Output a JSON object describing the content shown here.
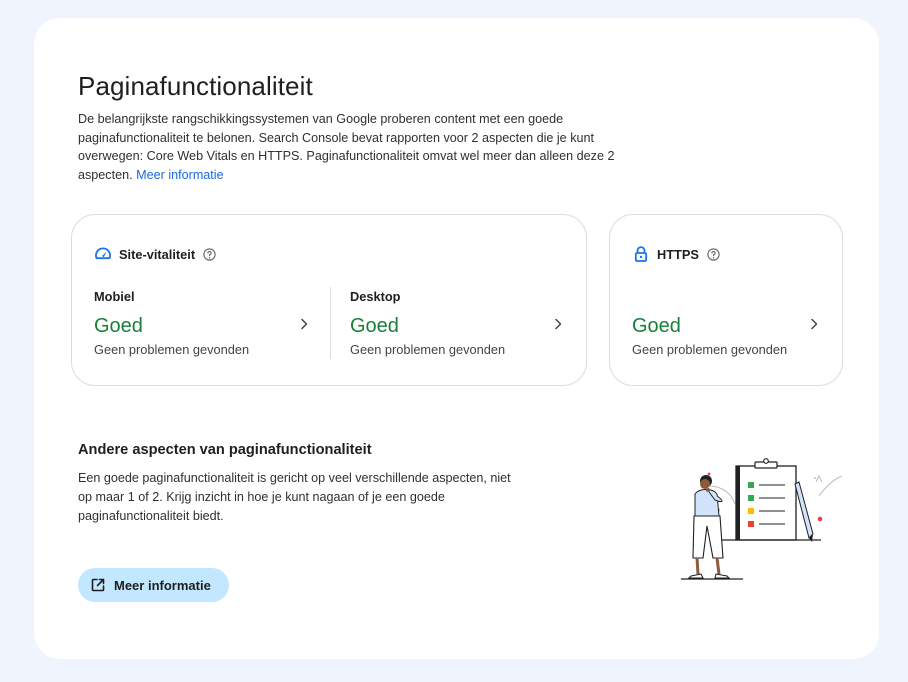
{
  "page": {
    "title": "Paginafunctionaliteit",
    "intro_text": "De belangrijkste rangschikkingssystemen van Google proberen content met een goede paginafunctionaliteit te belonen. Search Console bevat rapporten voor 2 aspecten die je kunt overwegen: Core Web Vitals en HTTPS. Paginafunctionaliteit omvat wel meer dan alleen deze 2 aspecten.",
    "intro_link": "Meer informatie"
  },
  "vitals_card": {
    "title": "Site-vitaliteit",
    "icon": "speedometer-icon",
    "mobile": {
      "label": "Mobiel",
      "status": "Goed",
      "description": "Geen problemen gevonden"
    },
    "desktop": {
      "label": "Desktop",
      "status": "Goed",
      "description": "Geen problemen gevonden"
    }
  },
  "https_card": {
    "title": "HTTPS",
    "icon": "lock-icon",
    "status": "Goed",
    "description": "Geen problemen gevonden"
  },
  "other_aspects": {
    "title": "Andere aspecten van paginafunctionaliteit",
    "text": "Een goede paginafunctionaliteit is gericht op veel verschillende aspecten, niet op maar 1 of 2. Krijg inzicht in hoe je kunt nagaan of je een goede paginafunctionaliteit biedt.",
    "button_label": "Meer informatie",
    "button_icon": "open-in-new-icon"
  },
  "colors": {
    "good": "#188038",
    "link": "#1a6ae0",
    "accent_icon": "#1a73e8",
    "button_bg": "#c2e7ff",
    "page_bg": "#f0f4fc"
  }
}
